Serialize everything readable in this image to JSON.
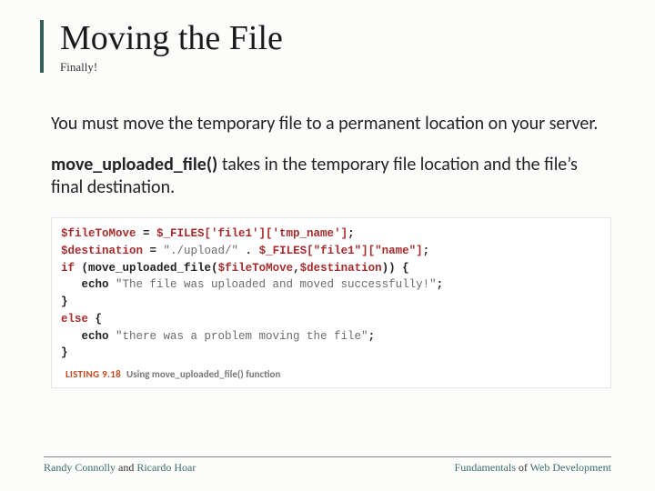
{
  "title": "Moving the File",
  "subtitle": "Finally!",
  "para1": "You must move the temporary file to a permanent location on your server.",
  "para2_fn": "move_uploaded_file()",
  "para2_rest": " takes in the temporary file location and the file’s final destination.",
  "code": {
    "l1a": "$fileToMove",
    "l1b": " = ",
    "l1c": "$_FILES['file1']['tmp_name']",
    "l1d": ";",
    "l2a": "$destination",
    "l2b": " = ",
    "l2c": "\"./upload/\"",
    "l2d": " . ",
    "l2e": "$_FILES[\"file1\"][\"name\"]",
    "l2f": ";",
    "l3a": "if",
    "l3b": " (",
    "l3c": "move_uploaded_file",
    "l3d": "(",
    "l3e": "$fileToMove",
    "l3f": ",",
    "l3g": "$destination",
    "l3h": ")) {",
    "l4a": "   echo ",
    "l4b": "\"The file was uploaded and moved successfully!\"",
    "l4c": ";",
    "l5": "}",
    "l6a": "else",
    "l6b": " {",
    "l7a": "   echo ",
    "l7b": "\"there was a problem moving the file\"",
    "l7c": ";",
    "l8": "}"
  },
  "listing_label": "LISTING 9.18",
  "listing_caption": "Using move_uploaded_file() function",
  "footer": {
    "author1": "Randy Connolly",
    "and": " and ",
    "author2": "Ricardo Hoar",
    "book1": "Fundamentals",
    "of": " of ",
    "book2": "Web Development"
  }
}
